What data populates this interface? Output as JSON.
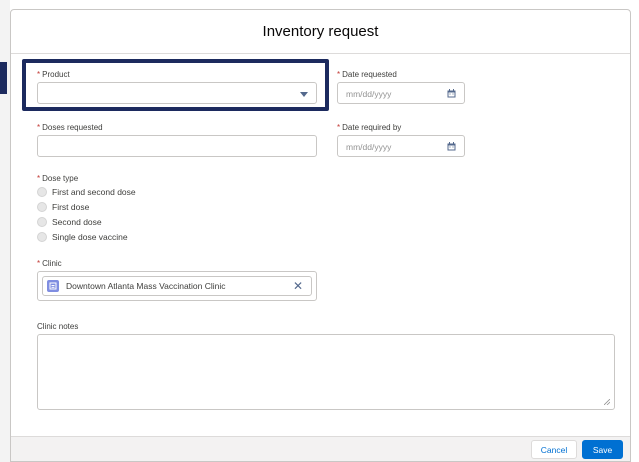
{
  "modal": {
    "title": "Inventory request"
  },
  "form": {
    "required_marker": "*",
    "product": {
      "label": "Product",
      "value": ""
    },
    "date_requested": {
      "label": "Date requested",
      "placeholder": "mm/dd/yyyy"
    },
    "doses_requested": {
      "label": "Doses requested",
      "value": ""
    },
    "date_required_by": {
      "label": "Date required by",
      "placeholder": "mm/dd/yyyy"
    },
    "dose_type": {
      "label": "Dose type",
      "options": [
        "First and second dose",
        "First dose",
        "Second dose",
        "Single dose vaccine"
      ]
    },
    "clinic": {
      "label": "Clinic",
      "selected": "Downtown Atlanta Mass Vaccination Clinic"
    },
    "clinic_notes": {
      "label": "Clinic notes",
      "value": ""
    }
  },
  "footer": {
    "cancel_label": "Cancel",
    "save_label": "Save"
  },
  "colors": {
    "accent": "#0070d2",
    "highlight": "#1c2a5e",
    "required": "#c23934",
    "clinic_icon": "#7f8de1"
  },
  "icons": {
    "product_dropdown": "chevron-down-icon",
    "date_picker": "calendar-icon",
    "clinic_record": "record-icon",
    "remove": "close-icon"
  }
}
